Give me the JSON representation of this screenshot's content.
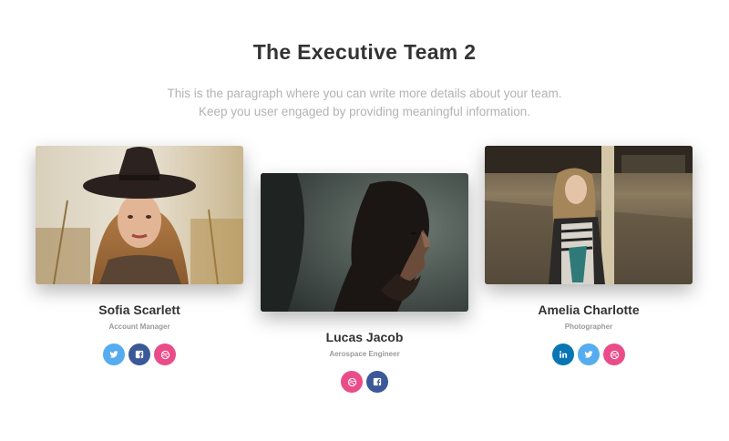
{
  "section": {
    "title": "The Executive Team 2",
    "paragraph": "This is the paragraph where you can write more details about your team. Keep you user engaged by providing meaningful information."
  },
  "members": [
    {
      "name": "Sofia Scarlett",
      "role": "Account Manager",
      "socials": [
        "twitter",
        "facebook",
        "dribbble"
      ]
    },
    {
      "name": "Lucas Jacob",
      "role": "Aerospace Engineer",
      "socials": [
        "dribbble",
        "facebook"
      ]
    },
    {
      "name": "Amelia Charlotte",
      "role": "Photographer",
      "socials": [
        "linkedin",
        "twitter",
        "dribbble"
      ]
    }
  ],
  "colors": {
    "twitter": "#55acee",
    "facebook": "#3b5998",
    "dribbble": "#ea4c89",
    "linkedin": "#0976b4",
    "title": "#333333",
    "paragraph": "#b3b3b3"
  }
}
